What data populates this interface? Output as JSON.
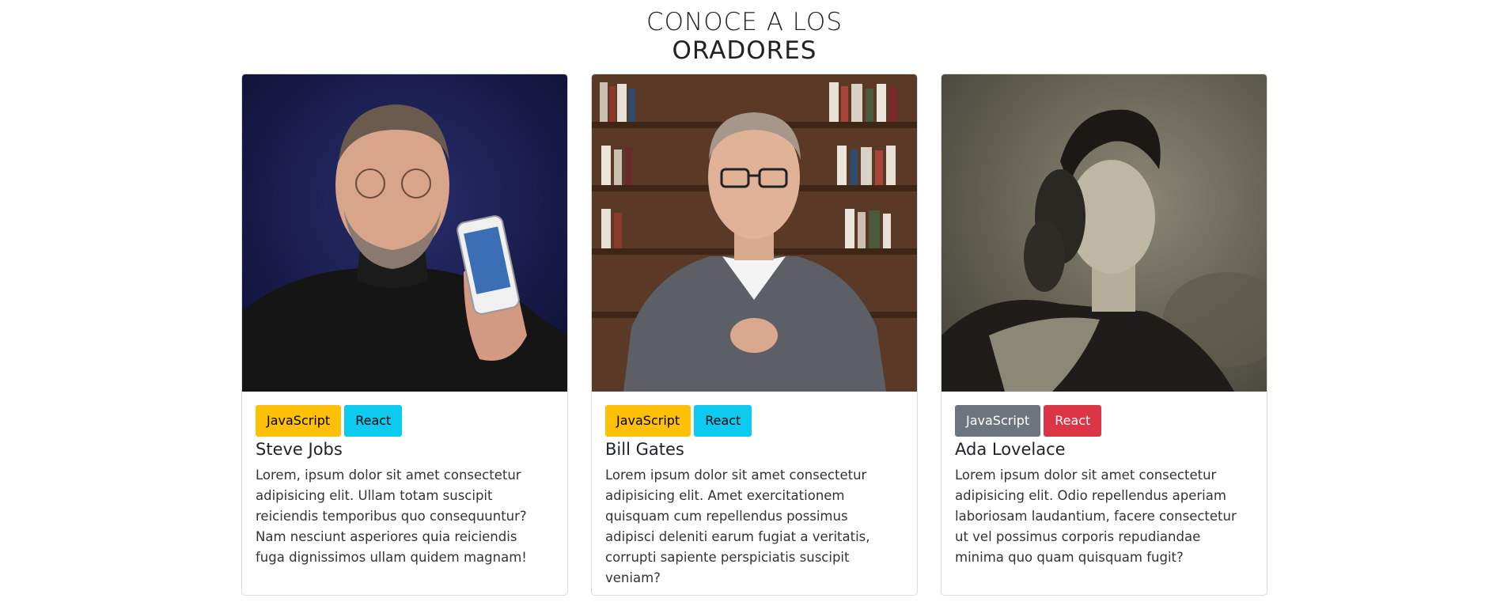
{
  "heading": {
    "line1": "CONOCE A LOS",
    "line2": "ORADORES"
  },
  "speakers": [
    {
      "name": "Steve Jobs",
      "description": "Lorem, ipsum dolor sit amet consectetur adipisicing elit. Ullam totam suscipit reiciendis temporibus quo consequuntur? Nam nesciunt asperiores quia reiciendis fuga dignissimos ullam quidem magnam!",
      "badges": [
        {
          "label": "JavaScript",
          "bg": "#ffc107",
          "fg": "#000000"
        },
        {
          "label": "React",
          "bg": "#0dcaf0",
          "fg": "#000000"
        }
      ]
    },
    {
      "name": "Bill Gates",
      "description": "Lorem ipsum dolor sit amet consectetur adipisicing elit. Amet exercitationem quisquam cum repellendus possimus adipisci deleniti earum fugiat a veritatis, corrupti sapiente perspiciatis suscipit veniam?",
      "badges": [
        {
          "label": "JavaScript",
          "bg": "#ffc107",
          "fg": "#000000"
        },
        {
          "label": "React",
          "bg": "#0dcaf0",
          "fg": "#000000"
        }
      ]
    },
    {
      "name": "Ada Lovelace",
      "description": "Lorem ipsum dolor sit amet consectetur adipisicing elit. Odio repellendus aperiam laboriosam laudantium, facere consectetur ut vel possimus corporis repudiandae minima quo quam quisquam fugit?",
      "badges": [
        {
          "label": "JavaScript",
          "bg": "#6c757d",
          "fg": "#ffffff"
        },
        {
          "label": "React",
          "bg": "#dc3545",
          "fg": "#ffffff"
        }
      ]
    }
  ]
}
